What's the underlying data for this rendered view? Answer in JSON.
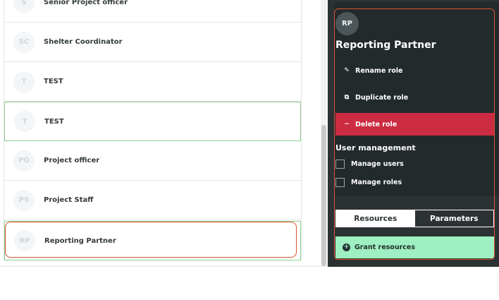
{
  "roles_list": [
    {
      "initials": "S",
      "name": "Senior Project officer"
    },
    {
      "initials": "SC",
      "name": "Shelter Coordinator"
    },
    {
      "initials": "T",
      "name": "TEST"
    },
    {
      "initials": "T",
      "name": "TEST"
    },
    {
      "initials": "PO",
      "name": "Project officer"
    },
    {
      "initials": "PS",
      "name": "Project Staff"
    },
    {
      "initials": "RP",
      "name": "Reporting Partner"
    }
  ],
  "role_panel": {
    "initials": "RP",
    "title": "Reporting Partner",
    "actions": {
      "rename": "Rename role",
      "duplicate": "Duplicate role",
      "delete": "Delete role"
    },
    "user_management": {
      "title": "User management",
      "manage_users": "Manage users",
      "manage_roles": "Manage roles"
    },
    "tabs": {
      "resources": "Resources",
      "parameters": "Parameters"
    },
    "grant_label": "Grant resources"
  },
  "colors": {
    "panel_dark": "#2c3234",
    "delete_red": "#cc2c41",
    "grant_green": "#9eefc1",
    "highlight_outline": "#d9532f"
  }
}
